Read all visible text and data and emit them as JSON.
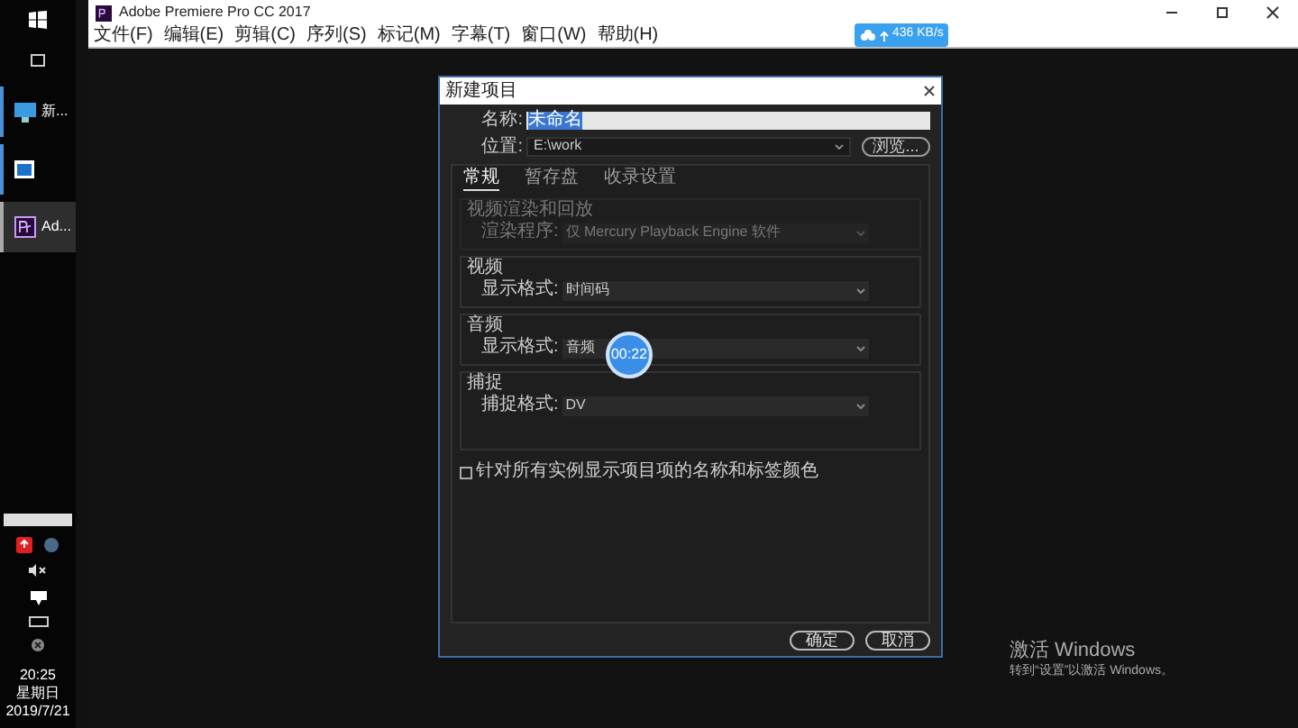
{
  "taskbar": {
    "items": [
      {
        "kind": "start"
      },
      {
        "kind": "taskview"
      },
      {
        "kind": "computer",
        "label": "新...",
        "selected": false
      },
      {
        "kind": "window",
        "selected": false
      },
      {
        "kind": "premiere",
        "label": "Ad...",
        "selected": true
      }
    ],
    "clock": {
      "time": "20:25",
      "day": "星期日",
      "date": "2019/7/21"
    }
  },
  "window": {
    "title": "Adobe Premiere Pro CC 2017",
    "menu": [
      "文件(F)",
      "编辑(E)",
      "剪辑(C)",
      "序列(S)",
      "标记(M)",
      "字幕(T)",
      "窗口(W)",
      "帮助(H)"
    ]
  },
  "upload_badge": {
    "speed": "436 KB/s"
  },
  "dialog": {
    "title": "新建项目",
    "name_label": "名称:",
    "name_value": "未命名",
    "location_label": "位置:",
    "location_value": "E:\\work",
    "browse": "浏览...",
    "tabs": [
      {
        "label": "常规",
        "selected": true
      },
      {
        "label": "暂存盘",
        "selected": false
      },
      {
        "label": "收录设置",
        "selected": false
      }
    ],
    "sections": [
      {
        "title": "视频渲染和回放",
        "disabled": true,
        "rows": [
          {
            "label": "渲染程序:",
            "value": "仅 Mercury Playback Engine 软件"
          }
        ]
      },
      {
        "title": "视频",
        "disabled": false,
        "rows": [
          {
            "label": "显示格式:",
            "value": "时间码"
          }
        ]
      },
      {
        "title": "音频",
        "disabled": false,
        "rows": [
          {
            "label": "显示格式:",
            "value": "音频"
          }
        ]
      },
      {
        "title": "捕捉",
        "disabled": false,
        "rows": [
          {
            "label": "捕捉格式:",
            "value": "DV"
          }
        ]
      }
    ],
    "checkbox": {
      "label": "针对所有实例显示项目项的名称和标签颜色",
      "checked": false
    },
    "buttons": [
      "确定",
      "取消"
    ]
  },
  "recording_timer": "00:22",
  "activation": {
    "title": "激活 Windows",
    "hint": "转到“设置”以激活 Windows。"
  }
}
